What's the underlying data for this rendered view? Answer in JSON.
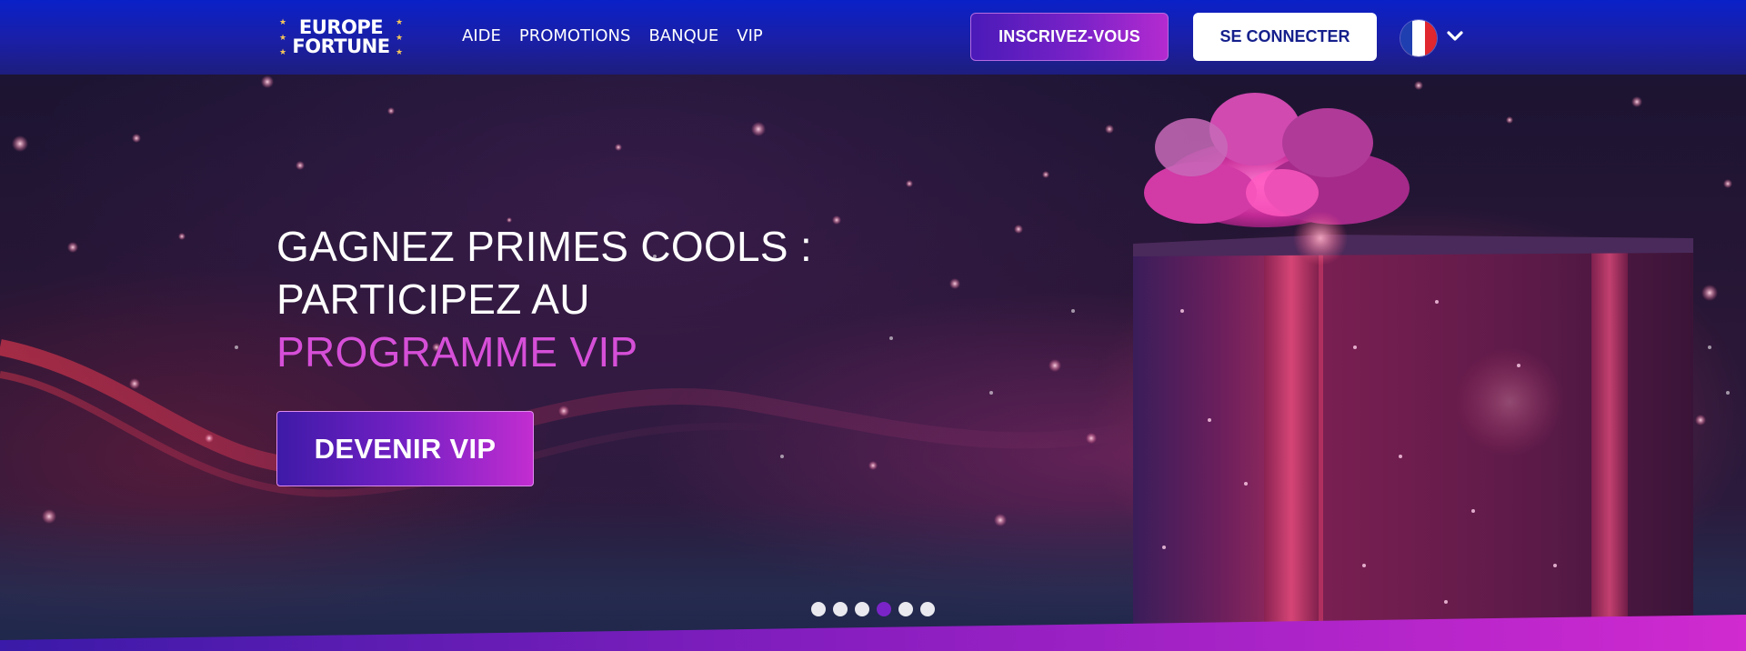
{
  "header": {
    "logo": {
      "line1": "EUROPE",
      "line2": "FORTUNE",
      "star_color": "#f4c65a"
    },
    "nav": [
      {
        "label": "AIDE"
      },
      {
        "label": "PROMOTIONS"
      },
      {
        "label": "BANQUE"
      },
      {
        "label": "VIP"
      }
    ],
    "signup_label": "INSCRIVEZ-VOUS",
    "login_label": "SE CONNECTER",
    "language": {
      "flag": "france-flag-icon",
      "colors": [
        "#1f3fb0",
        "#ffffff",
        "#e0262e"
      ]
    }
  },
  "hero": {
    "headline_line1": "GAGNEZ PRIMES COOLS :",
    "headline_line2": "PARTICIPEZ AU",
    "headline_accent": "PROGRAMME VIP",
    "cta_label": "DEVENIR VIP",
    "image": "gift-box-illustration",
    "carousel": {
      "total": 6,
      "active_index": 3
    }
  },
  "colors": {
    "header_bg": "#1a1fa6",
    "accent_pink": "#d64fd8",
    "button_gradient_start": "#3e1aa8",
    "button_gradient_end": "#c22dd0",
    "login_text": "#16208c"
  }
}
